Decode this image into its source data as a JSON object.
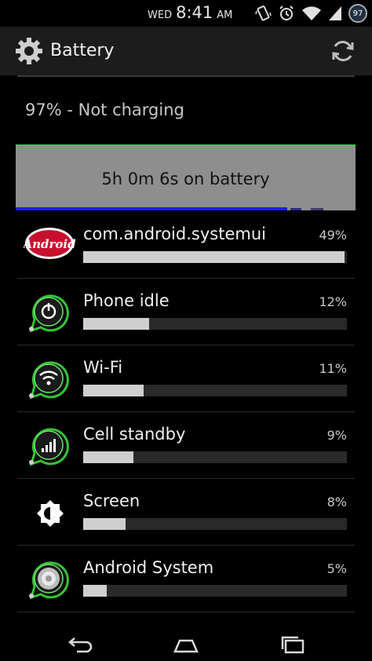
{
  "status_bar": {
    "day": "WED",
    "time": "8:41",
    "ampm": "AM",
    "battery_level": "97",
    "icons": [
      "vibrate-icon",
      "alarm-icon",
      "wifi-icon",
      "signal-icon",
      "battery-icon"
    ]
  },
  "action_bar": {
    "title": "Battery",
    "icons": [
      "gear-icon",
      "refresh-icon"
    ]
  },
  "battery": {
    "status": "97% - Not charging",
    "graph_label": "5h 0m 6s on battery"
  },
  "usage_items": [
    {
      "name": "com.android.systemui",
      "percent": "49%",
      "fraction": 0.99,
      "icon": "android-logo-icon"
    },
    {
      "name": "Phone idle",
      "percent": "12%",
      "fraction": 0.25,
      "icon": "power-icon"
    },
    {
      "name": "Wi-Fi",
      "percent": "11%",
      "fraction": 0.23,
      "icon": "wifi-icon"
    },
    {
      "name": "Cell standby",
      "percent": "9%",
      "fraction": 0.19,
      "icon": "signal-icon"
    },
    {
      "name": "Screen",
      "percent": "8%",
      "fraction": 0.16,
      "icon": "brightness-icon"
    },
    {
      "name": "Android System",
      "percent": "5%",
      "fraction": 0.09,
      "icon": "android-system-icon"
    }
  ],
  "colors": {
    "graph_border": "#3bd13b",
    "graph_line": "#1a1aff",
    "bar_fill": "#cfcfcf",
    "bar_track": "#2a2a2a"
  },
  "nav_bar": {
    "icons": [
      "back-icon",
      "home-icon",
      "recents-icon"
    ]
  }
}
